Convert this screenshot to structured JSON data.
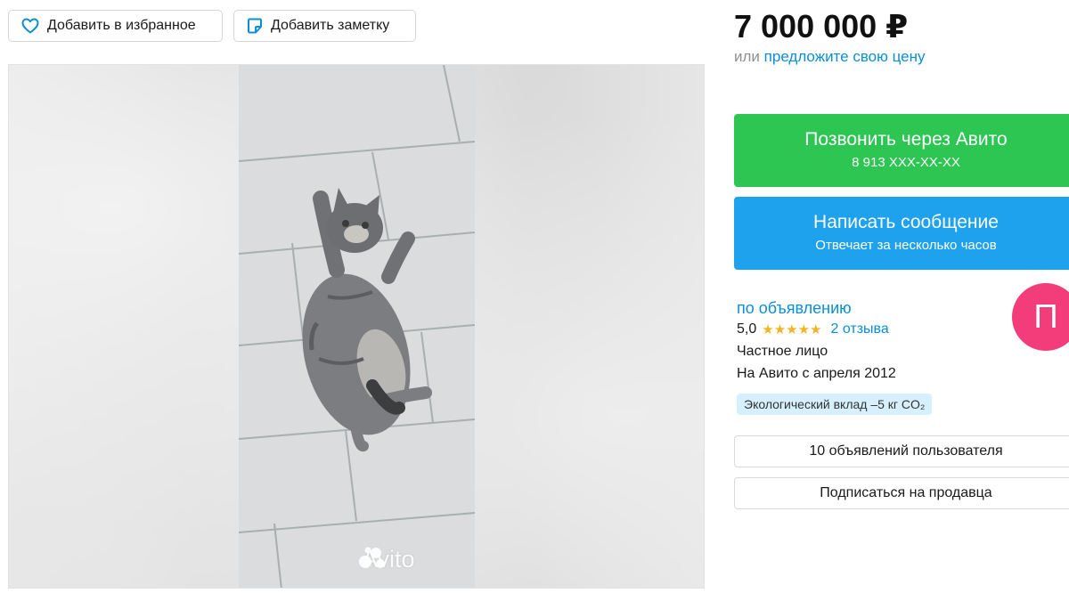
{
  "actions": {
    "favorite_label": "Добавить в избранное",
    "note_label": "Добавить заметку"
  },
  "price": {
    "value": "7 000 000 ₽",
    "or_label": "или",
    "offer_link": "предложите свою цену"
  },
  "contact": {
    "call_label": "Позвонить через Авито",
    "phone_masked": "8 913 XXX-XX-XX",
    "message_label": "Написать сообщение",
    "response_time": "Отвечает за несколько часов"
  },
  "seller": {
    "name": "по объявлению",
    "rating": "5,0",
    "stars": 5,
    "stars_glyphs": "★★★★★",
    "reviews": "2 отзыва",
    "type": "Частное лицо",
    "since": "На Авито с апреля 2012",
    "eco_badge": "Экологический вклад –5 кг CO₂",
    "avatar_letter": "П",
    "avatar_color": "#f23d7a",
    "listings_button": "10 объявлений пользователя",
    "subscribe_button": "Подписаться на продавца"
  },
  "gallery": {
    "watermark": "Avito"
  },
  "colors": {
    "call_button": "#2dc652",
    "message_button": "#1fa2ee",
    "link": "#0a8fd6",
    "stars": "#f6b326"
  },
  "icons": {
    "favorite": "heart-icon",
    "note": "sticky-note-icon",
    "watermark": "avito-logo-icon"
  }
}
